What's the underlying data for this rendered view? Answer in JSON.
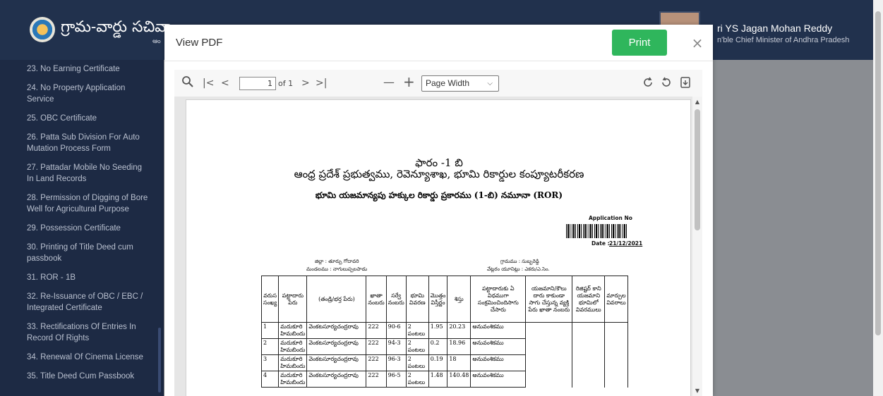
{
  "app": {
    "brand": "గ్రామ-వార్డు సచివా",
    "brand_sub": "ఆం",
    "cm_name": "ri YS Jagan Mohan Reddy",
    "cm_title": "n'ble Chief Minister of Andhra Pradesh"
  },
  "sidebar": {
    "items": [
      "23. No Earning Certificate",
      "24. No Property Application Service",
      "25. OBC Certificate",
      "26. Patta Sub Division For Auto Mutation Process Form",
      "27. Pattadar Mobile No Seeding In Land Records",
      "28. Permission of Digging of Bore Well for Agricultural Purpose",
      "29. Possession Certificate",
      "30. Printing of Title Deed cum passbook",
      "31. ROR - 1B",
      "32. Re-Issuance of OBC / EBC / Integrated Certificate",
      "33. Rectifications Of Entries In Record Of Rights",
      "34. Renewal Of Cinema License",
      "35. Title Deed Cum Passbook"
    ]
  },
  "modal": {
    "title": "View PDF",
    "print_label": "Print",
    "close_label": "×"
  },
  "viewer": {
    "search_icon": "search-icon",
    "first_label": "|<",
    "prev_label": "<",
    "page_value": "1",
    "page_of": "of 1",
    "next_label": ">",
    "last_label": ">|",
    "zoom_out_label": "—",
    "zoom_in_label": "+",
    "zoom_value": "Page Width"
  },
  "document": {
    "form_title": "ఫారం -1 బి",
    "heading": "ఆంధ్ర ప్రదేశ్ ప్రభుత్వము, రెవెన్యూశాఖ, భూమి రికార్డుల కంప్యూటరీకరణ",
    "subheading": "భూమి యజమాన్యపు హక్కుల రికార్డు ప్రకారము (1-బి) నమూనా (ROR)",
    "application_no_label": "Application No",
    "date_label": "Date :",
    "date_value": "21/12/2021",
    "district": "జిల్లా : తూర్పు గోదావరి",
    "mandal": "మండలము : నాగులుప్పలపాడు",
    "village": "గ్రామము : సుబ్బరెడ్డి",
    "village_sub": "వేట్లరం యూనిట్లు : ఎకరు/ఎ.సెం.",
    "columns": [
      "వరుస సంఖ్య",
      "పట్టాదారు పేరు",
      "(తండ్రి/భర్త పేరు)",
      "ఖాతా నంబరు",
      "సర్వే నంబరు",
      "భూమి వివరణ",
      "మొత్తం విస్తీర్ణం",
      "శిస్తు",
      "పట్టాదారుకు ఏ విధముగా సంక్రమించిందిసాగు చేసారు",
      "యజమాని/కౌలు దారు కాకుండా సాగు చేస్తున్న వ్యక్తి పేరు ఖాతా నంబరు",
      "రిజిష్టర్ కాని యజమాని భూమిలో వివరములు",
      "మార్పుల వివరాలు"
    ],
    "rows": [
      [
        "1",
        "మదుకూరి హిమబిందు",
        "వెంకటసూర్యచంద్రరావు",
        "222",
        "90-6",
        "2 పంటలు",
        "1.95",
        "20.23",
        "అనువంశికము"
      ],
      [
        "2",
        "మదుకూరి హిమబిందు",
        "వెంకటసూర్యచంద్రరావు",
        "222",
        "94-3",
        "2 పంటలు",
        "0.2",
        "18.96",
        "అనువంశికము"
      ],
      [
        "3",
        "మదుకూరి హిమబిందు",
        "వెంకటసూర్యచంద్రరావు",
        "222",
        "96-3",
        "2 పంటలు",
        "0.19",
        "18",
        "అనువంశికము"
      ],
      [
        "4",
        "మదుకూరి హిమబిందు",
        "వెంకటసూర్యచంద్రరావు",
        "222",
        "96-5",
        "2 పంటలు",
        "1.48",
        "140.48",
        "అనువంశికము"
      ]
    ]
  }
}
